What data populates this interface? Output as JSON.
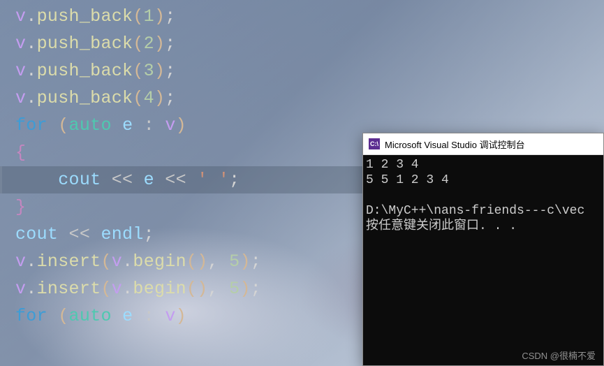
{
  "code": {
    "lines": [
      {
        "tokens": [
          {
            "t": "v",
            "c": "var"
          },
          {
            "t": ".",
            "c": "dot"
          },
          {
            "t": "push_back",
            "c": "fn"
          },
          {
            "t": "(",
            "c": "paren"
          },
          {
            "t": "1",
            "c": "num"
          },
          {
            "t": ")",
            "c": "paren"
          },
          {
            "t": ";",
            "c": "semi"
          }
        ]
      },
      {
        "tokens": [
          {
            "t": "v",
            "c": "var"
          },
          {
            "t": ".",
            "c": "dot"
          },
          {
            "t": "push_back",
            "c": "fn"
          },
          {
            "t": "(",
            "c": "paren"
          },
          {
            "t": "2",
            "c": "num"
          },
          {
            "t": ")",
            "c": "paren"
          },
          {
            "t": ";",
            "c": "semi"
          }
        ]
      },
      {
        "tokens": [
          {
            "t": "v",
            "c": "var"
          },
          {
            "t": ".",
            "c": "dot"
          },
          {
            "t": "push_back",
            "c": "fn"
          },
          {
            "t": "(",
            "c": "paren"
          },
          {
            "t": "3",
            "c": "num"
          },
          {
            "t": ")",
            "c": "paren"
          },
          {
            "t": ";",
            "c": "semi"
          }
        ]
      },
      {
        "tokens": [
          {
            "t": "v",
            "c": "var"
          },
          {
            "t": ".",
            "c": "dot"
          },
          {
            "t": "push_back",
            "c": "fn"
          },
          {
            "t": "(",
            "c": "paren"
          },
          {
            "t": "4",
            "c": "num"
          },
          {
            "t": ")",
            "c": "paren"
          },
          {
            "t": ";",
            "c": "semi"
          }
        ]
      },
      {
        "tokens": [
          {
            "t": "for",
            "c": "kw"
          },
          {
            "t": " ",
            "c": "dot"
          },
          {
            "t": "(",
            "c": "paren"
          },
          {
            "t": "auto",
            "c": "type"
          },
          {
            "t": " ",
            "c": "dot"
          },
          {
            "t": "e",
            "c": "id"
          },
          {
            "t": " ",
            "c": "dot"
          },
          {
            "t": ":",
            "c": "op"
          },
          {
            "t": " ",
            "c": "dot"
          },
          {
            "t": "v",
            "c": "var"
          },
          {
            "t": ")",
            "c": "paren"
          }
        ]
      },
      {
        "tokens": [
          {
            "t": "{",
            "c": "brace"
          }
        ]
      },
      {
        "hl": true,
        "tokens": [
          {
            "t": "    ",
            "c": "dot"
          },
          {
            "t": "cout",
            "c": "id"
          },
          {
            "t": " ",
            "c": "dot"
          },
          {
            "t": "<<",
            "c": "op"
          },
          {
            "t": " ",
            "c": "dot"
          },
          {
            "t": "e",
            "c": "id"
          },
          {
            "t": " ",
            "c": "dot"
          },
          {
            "t": "<<",
            "c": "op"
          },
          {
            "t": " ",
            "c": "dot"
          },
          {
            "t": "' '",
            "c": "str"
          },
          {
            "t": ";",
            "c": "semi"
          }
        ]
      },
      {
        "tokens": [
          {
            "t": "}",
            "c": "brace"
          }
        ]
      },
      {
        "tokens": [
          {
            "t": "cout",
            "c": "id"
          },
          {
            "t": " ",
            "c": "dot"
          },
          {
            "t": "<<",
            "c": "op"
          },
          {
            "t": " ",
            "c": "dot"
          },
          {
            "t": "endl",
            "c": "id"
          },
          {
            "t": ";",
            "c": "semi"
          }
        ]
      },
      {
        "tokens": [
          {
            "t": "v",
            "c": "var"
          },
          {
            "t": ".",
            "c": "dot"
          },
          {
            "t": "insert",
            "c": "fn"
          },
          {
            "t": "(",
            "c": "paren"
          },
          {
            "t": "v",
            "c": "var"
          },
          {
            "t": ".",
            "c": "dot"
          },
          {
            "t": "begin",
            "c": "fn"
          },
          {
            "t": "(",
            "c": "paren"
          },
          {
            "t": ")",
            "c": "paren"
          },
          {
            "t": ",",
            "c": "dot"
          },
          {
            "t": " ",
            "c": "dot"
          },
          {
            "t": "5",
            "c": "num"
          },
          {
            "t": ")",
            "c": "paren"
          },
          {
            "t": ";",
            "c": "semi"
          }
        ]
      },
      {
        "tokens": [
          {
            "t": "v",
            "c": "var"
          },
          {
            "t": ".",
            "c": "dot"
          },
          {
            "t": "insert",
            "c": "fn"
          },
          {
            "t": "(",
            "c": "paren"
          },
          {
            "t": "v",
            "c": "var"
          },
          {
            "t": ".",
            "c": "dot"
          },
          {
            "t": "begin",
            "c": "fn"
          },
          {
            "t": "(",
            "c": "paren"
          },
          {
            "t": ")",
            "c": "paren"
          },
          {
            "t": ",",
            "c": "dot"
          },
          {
            "t": " ",
            "c": "dot"
          },
          {
            "t": "5",
            "c": "num"
          },
          {
            "t": ")",
            "c": "paren"
          },
          {
            "t": ";",
            "c": "semi"
          }
        ]
      },
      {
        "tokens": [
          {
            "t": "for",
            "c": "kw"
          },
          {
            "t": " ",
            "c": "dot"
          },
          {
            "t": "(",
            "c": "paren"
          },
          {
            "t": "auto",
            "c": "type"
          },
          {
            "t": " ",
            "c": "dot"
          },
          {
            "t": "e",
            "c": "id"
          },
          {
            "t": " ",
            "c": "dot"
          },
          {
            "t": ":",
            "c": "op"
          },
          {
            "t": " ",
            "c": "dot"
          },
          {
            "t": "v",
            "c": "var"
          },
          {
            "t": ")",
            "c": "paren"
          }
        ]
      }
    ]
  },
  "console": {
    "icon_text": "C:\\",
    "title": "Microsoft Visual Studio 调试控制台",
    "output": "1 2 3 4\n5 5 1 2 3 4\n\nD:\\MyC++\\nans-friends---c\\vec\n按任意键关闭此窗口. . ."
  },
  "watermark": "CSDN @很楠不爱"
}
